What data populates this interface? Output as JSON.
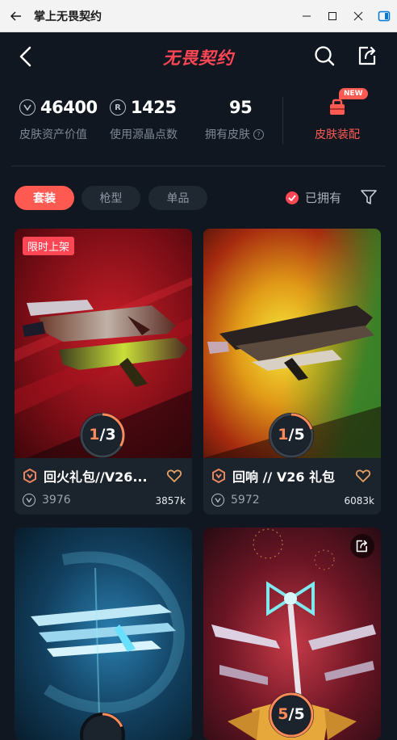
{
  "window": {
    "title": "掌上无畏契约"
  },
  "header": {
    "logo_text": "无畏契约"
  },
  "stats": {
    "asset_value": {
      "value": "46400",
      "label": "皮肤资产价值"
    },
    "radianite": {
      "value": "1425",
      "label": "使用源晶点数",
      "icon_letter": "R"
    },
    "owned_skins": {
      "value": "95",
      "label": "拥有皮肤"
    },
    "equip": {
      "badge": "NEW",
      "label": "皮肤装配"
    }
  },
  "filters": {
    "tabs": [
      "套装",
      "枪型",
      "单品"
    ],
    "active_tab": "套装",
    "owned_label": "已拥有"
  },
  "cards": [
    {
      "title": "回火礼包//V26...",
      "price": "3976",
      "likes": "3857k",
      "tag": "限时上架",
      "progress_owned": "1",
      "progress_total": "3",
      "progress_fraction": 0.333,
      "accent": "#ff4655"
    },
    {
      "title": "回响 // V26 礼包",
      "price": "5972",
      "likes": "6083k",
      "progress_owned": "1",
      "progress_total": "5",
      "progress_fraction": 0.2,
      "accent": "#ff4655"
    },
    {
      "progress_owned": "",
      "progress_total": ""
    },
    {
      "progress_owned": "5",
      "progress_total": "5",
      "progress_fraction": 1.0
    }
  ],
  "colors": {
    "accent": "#ff4655",
    "background": "#101720",
    "card": "#1b232d"
  }
}
